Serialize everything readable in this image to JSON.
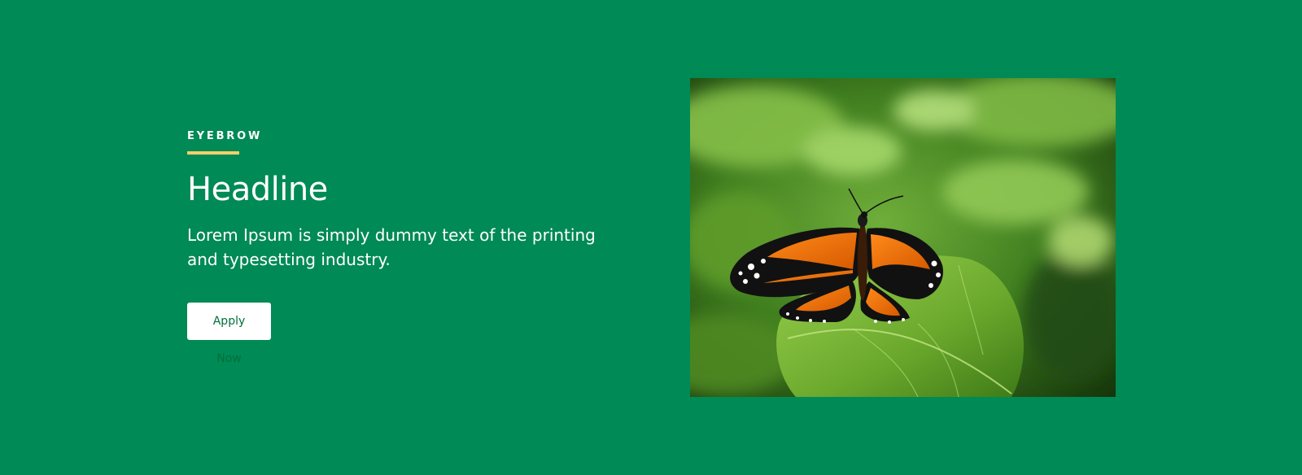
{
  "hero": {
    "eyebrow": "EYEBROW",
    "headline": "Headline",
    "body": "Lorem Ipsum is simply dummy text of the printing and typesetting industry.",
    "cta_label": "Apply Now"
  },
  "colors": {
    "background": "#008a55",
    "eyebrow_accent": "#f5cf6b",
    "button_text": "#00703c"
  },
  "image": {
    "subject": "monarch-butterfly-on-leaf"
  }
}
